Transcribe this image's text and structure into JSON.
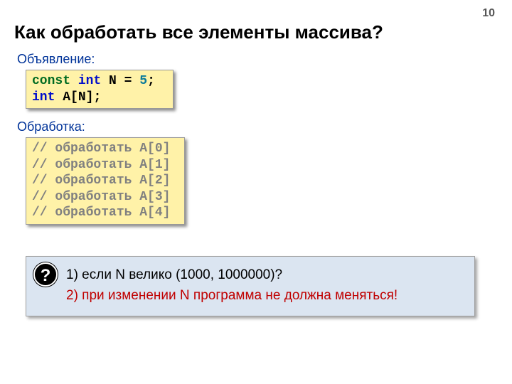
{
  "page_number": "10",
  "title": "Как обработать все элементы массива?",
  "labels": {
    "declaration": "Объявление:",
    "processing": "Обработка:"
  },
  "code_declaration": {
    "kw_const": "const",
    "kw_int1": "int",
    "ident_N": "N",
    "assign": " = ",
    "num5": "5",
    "semi1": ";",
    "kw_int2": "int",
    "ident_A": "A[N]",
    "semi2": ";"
  },
  "code_processing": {
    "line0": "// обработать A[0]",
    "line1": "// обработать A[1]",
    "line2": "// обработать A[2]",
    "line3": "// обработать A[3]",
    "line4": "// обработать A[4]"
  },
  "question": {
    "icon": "?",
    "line1": "1) если N велико (1000, 1000000)?",
    "line2": "2) при изменении N программа не должна меняться!"
  }
}
